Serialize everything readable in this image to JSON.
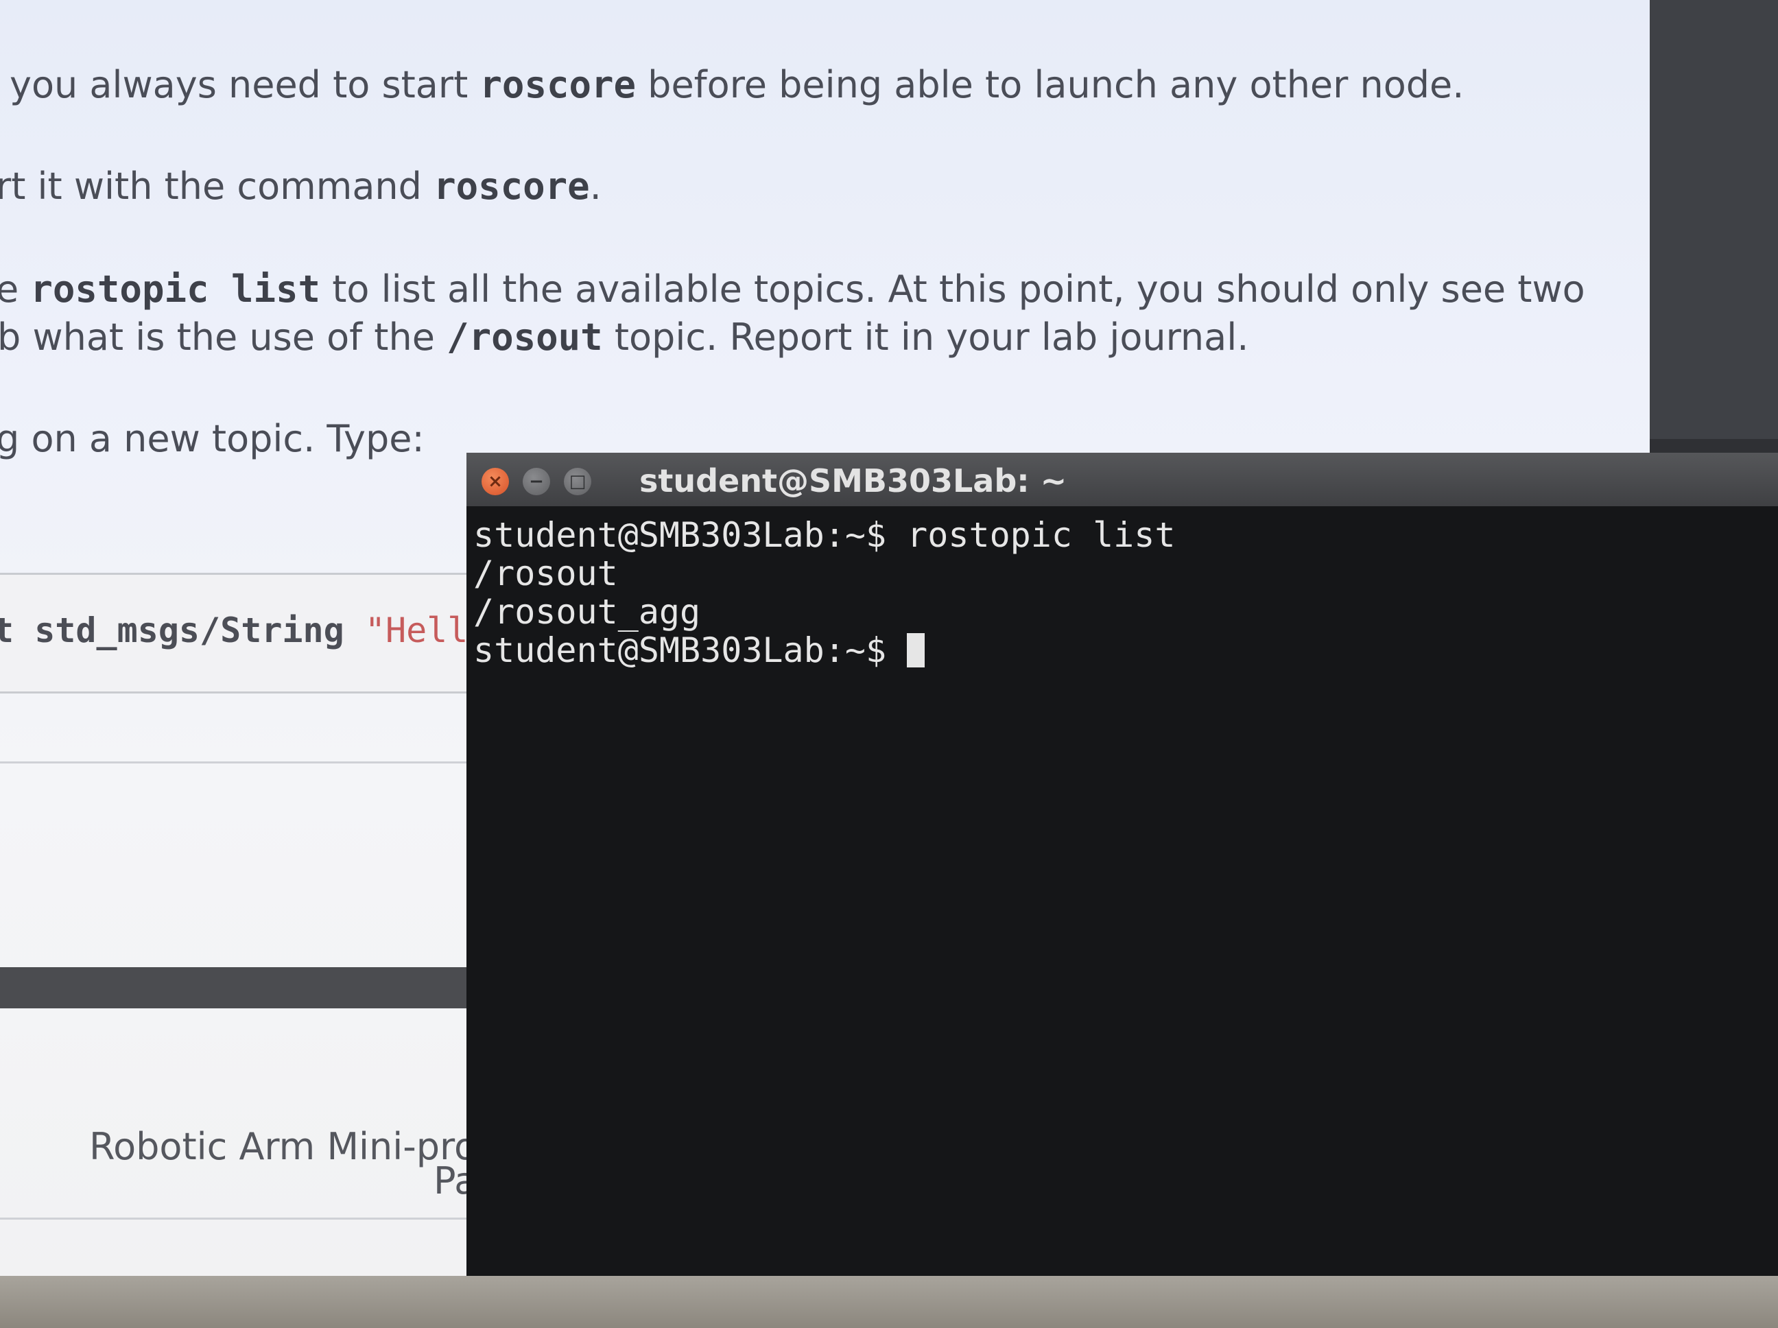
{
  "document": {
    "line1_a": "you always need to start ",
    "line1_code": "roscore",
    "line1_b": " before being able to launch any other node.",
    "line2_a": "rt it with the command ",
    "line2_code": "roscore",
    "line2_b": ".",
    "line3_a": "e ",
    "line3_code": "rostopic list",
    "line3_b": " to list all the available topics. At this point, you should only see two",
    "line4_a": "b what is the use of the ",
    "line4_code": "/rosout",
    "line4_b": " topic. Report it in your lab journal.",
    "line5": "g on a new topic. Type:",
    "code_snippet": "t std_msgs/String ",
    "code_string": "\"Hello",
    "footer_line1": "Robotic Arm Mini-projec",
    "footer_line2": "Par"
  },
  "terminal": {
    "title": "student@SMB303Lab: ~",
    "close_glyph": "×",
    "minimize_glyph": "−",
    "maximize_glyph": "□",
    "lines": [
      "student@SMB303Lab:~$ rostopic list",
      "/rosout",
      "/rosout_agg",
      "student@SMB303Lab:~$ "
    ]
  }
}
